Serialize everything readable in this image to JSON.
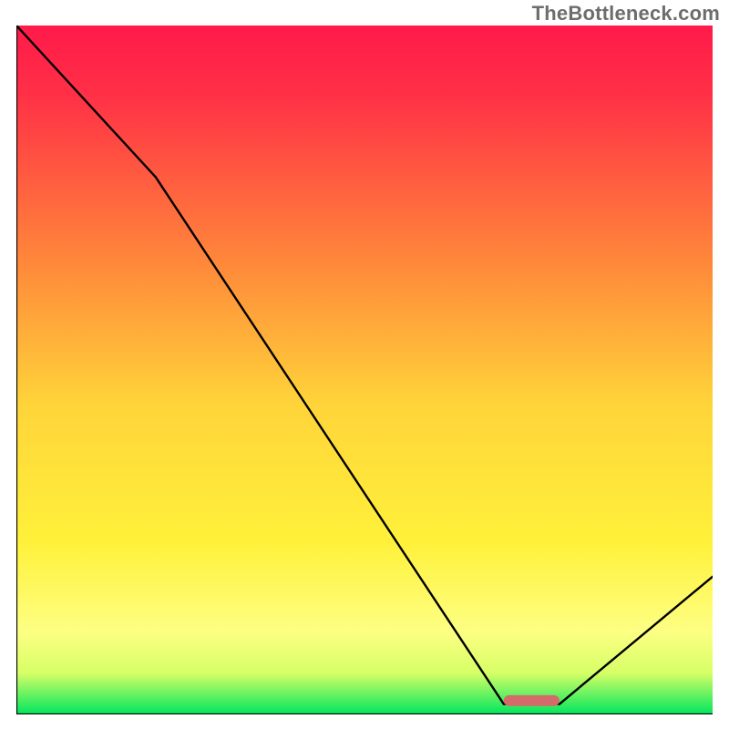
{
  "attribution": "TheBottleneck.com",
  "chart_data": {
    "type": "line",
    "title": "",
    "xlabel": "",
    "ylabel": "",
    "xlim": [
      0,
      100
    ],
    "ylim": [
      0,
      100
    ],
    "grid": false,
    "legend": false,
    "series": [
      {
        "name": "bottleneck-valley",
        "x": [
          0,
          20,
          70,
          78,
          100
        ],
        "y": [
          100,
          78,
          1.5,
          1.5,
          20
        ],
        "note": "curve starts at top-left, slope break near x≈20, falls to a flat floor at x≈70–78, then rises to top-right"
      }
    ],
    "marker": {
      "name": "optimal-range",
      "x_center": 74,
      "y": 2,
      "width": 8,
      "color": "#d56a6b",
      "note": "rounded pill sitting on the flat valley floor"
    },
    "background_gradient": [
      {
        "stop": 0.0,
        "color": "#ff1a4a"
      },
      {
        "stop": 0.1,
        "color": "#ff3046"
      },
      {
        "stop": 0.35,
        "color": "#ff8a3a"
      },
      {
        "stop": 0.55,
        "color": "#ffd43a"
      },
      {
        "stop": 0.75,
        "color": "#fff13a"
      },
      {
        "stop": 0.88,
        "color": "#fdff83"
      },
      {
        "stop": 0.94,
        "color": "#d6ff66"
      },
      {
        "stop": 1.0,
        "color": "#00e65e"
      }
    ]
  }
}
